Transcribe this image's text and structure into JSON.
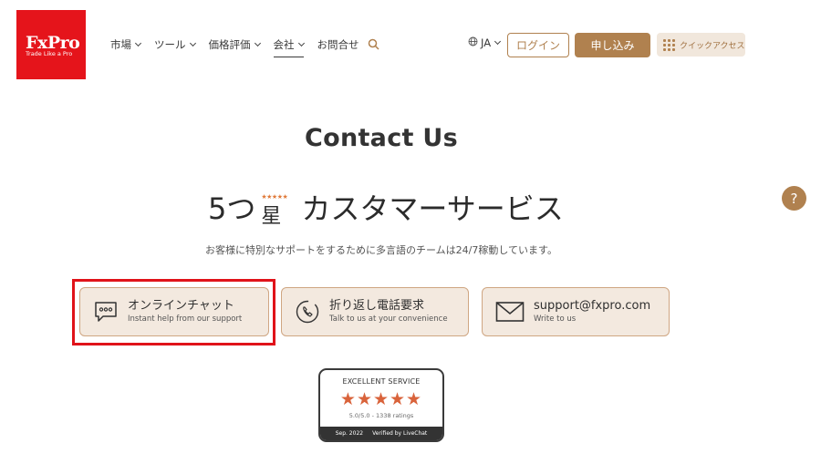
{
  "logo": {
    "name": "FxPro",
    "tagline": "Trade Like a Pro",
    "color": "#e5141b"
  },
  "nav": {
    "items": [
      {
        "label": "市場"
      },
      {
        "label": "ツール"
      },
      {
        "label": "価格評価"
      },
      {
        "label": "会社"
      },
      {
        "label": "お問合せ"
      }
    ]
  },
  "header": {
    "language": "JA",
    "login_label": "ログイン",
    "signup_label": "申し込み",
    "quick_access_label": "クイックアクセス",
    "accent_color": "#b0814f"
  },
  "hero": {
    "title": "Contact Us",
    "headline_prefix": "5つ",
    "headline_stars": "★★★★★",
    "headline_kanji": "星",
    "headline_suffix": "カスタマーサービス",
    "subline": "お客様に特別なサポートをするために多言語のチームは24/7稼動しています。"
  },
  "contact": {
    "chat": {
      "title": "オンラインチャット",
      "subtitle": "Instant help from our support"
    },
    "callback": {
      "title": "折り返し電話要求",
      "subtitle": "Talk to us at your convenience"
    },
    "email": {
      "title": "support@fxpro.com",
      "subtitle": "Write to us"
    }
  },
  "badge": {
    "title": "EXCELLENT SERVICE",
    "stars": "★★★★★",
    "rating": "5.0/5.0 - 1338 ratings",
    "date": "Sep. 2022",
    "verified": "Verified by LiveChat"
  },
  "help": {
    "glyph": "?"
  }
}
